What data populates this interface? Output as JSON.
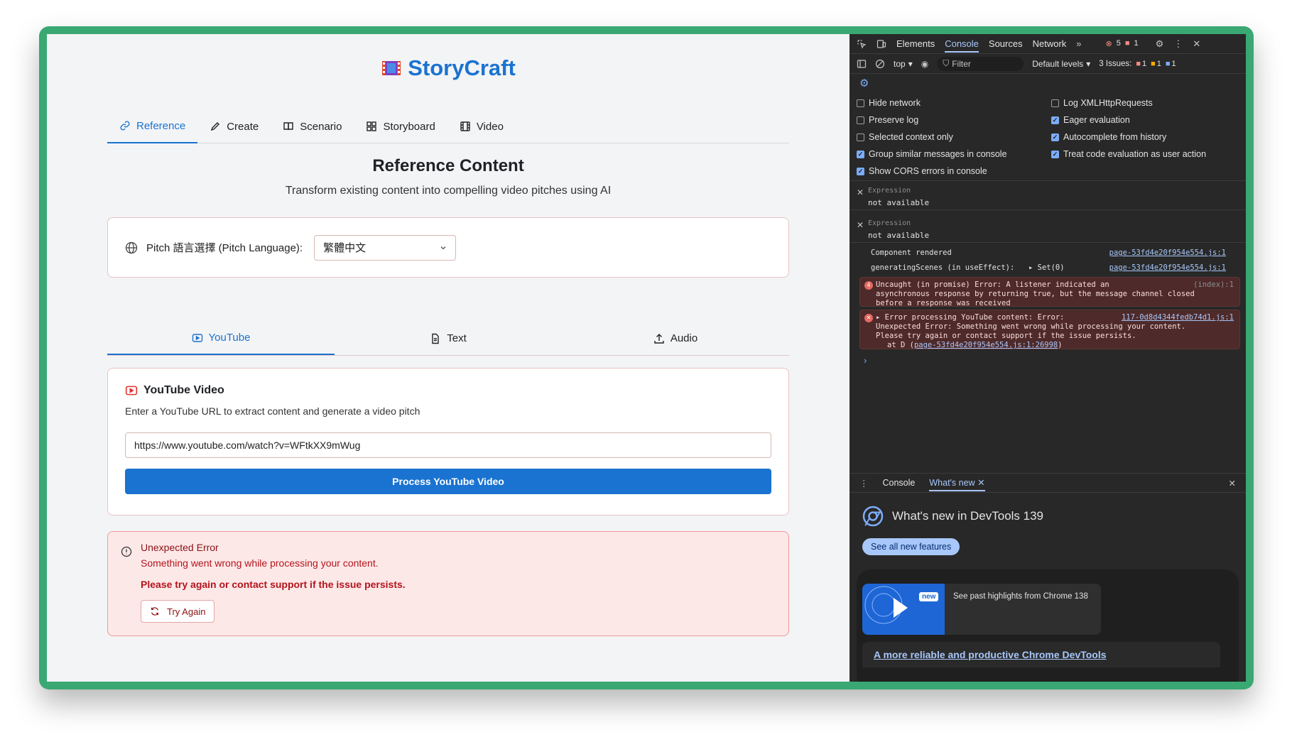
{
  "app": {
    "brand": "StoryCraft",
    "tabs": [
      {
        "label": "Reference",
        "icon": "link-icon"
      },
      {
        "label": "Create",
        "icon": "pencil-icon"
      },
      {
        "label": "Scenario",
        "icon": "book-icon"
      },
      {
        "label": "Storyboard",
        "icon": "grid-icon"
      },
      {
        "label": "Video",
        "icon": "film-icon"
      }
    ],
    "active_tab": "Reference",
    "heading": "Reference Content",
    "subheading": "Transform existing content into compelling video pitches using AI",
    "language": {
      "label": "Pitch 語言選擇 (Pitch Language):",
      "selected": "繁體中文"
    },
    "source_tabs": [
      {
        "label": "YouTube",
        "icon": "youtube-icon"
      },
      {
        "label": "Text",
        "icon": "document-icon"
      },
      {
        "label": "Audio",
        "icon": "upload-icon"
      }
    ],
    "active_source_tab": "YouTube",
    "youtube": {
      "title": "YouTube Video",
      "description": "Enter a YouTube URL to extract content and generate a video pitch",
      "url_value": "https://www.youtube.com/watch?v=WFtkXX9mWug",
      "button": "Process YouTube Video"
    },
    "error": {
      "title": "Unexpected Error",
      "message": "Something went wrong while processing your content.",
      "hint": "Please try again or contact support if the issue persists.",
      "retry": "Try Again"
    },
    "colors": {
      "accent": "#1a73d0",
      "error_bg": "#fde8e8",
      "error_text": "#b3141b"
    }
  },
  "devtools": {
    "tabs": [
      "Elements",
      "Console",
      "Sources",
      "Network"
    ],
    "active_tab": "Console",
    "error_count": "5",
    "warning_count": "1",
    "context": "top",
    "filter_placeholder": "Filter",
    "levels": "Default levels",
    "issues_label": "3 Issues:",
    "issues": {
      "red": "1",
      "orange": "1",
      "blue": "1"
    },
    "settings_left": [
      {
        "label": "Hide network",
        "checked": false
      },
      {
        "label": "Preserve log",
        "checked": false
      },
      {
        "label": "Selected context only",
        "checked": false
      },
      {
        "label": "Group similar messages in console",
        "checked": true
      },
      {
        "label": "Show CORS errors in console",
        "checked": true
      }
    ],
    "settings_right": [
      {
        "label": "Log XMLHttpRequests",
        "checked": false
      },
      {
        "label": "Eager evaluation",
        "checked": true
      },
      {
        "label": "Autocomplete from history",
        "checked": true
      },
      {
        "label": "Treat code evaluation as user action",
        "checked": true
      }
    ],
    "expressions": [
      {
        "label": "Expression",
        "value": "not available"
      },
      {
        "label": "Expression",
        "value": "not available"
      }
    ],
    "logs": [
      {
        "text": "Component rendered",
        "source": "page-53fd4e20f954e554.js:1"
      },
      {
        "text": "generatingScenes (in useEffect):",
        "extra": "▸ Set(0)",
        "source": "page-53fd4e20f954e554.js:1"
      }
    ],
    "error1": {
      "count": "4",
      "line1": "Uncaught (in promise) Error: A listener indicated an",
      "source": "(index):1",
      "line2": "asynchronous response by returning true, but the message channel closed",
      "line3": "before a response was received"
    },
    "error2": {
      "line1": "▸ Error processing YouTube content: Error:",
      "source": "117-0d8d4344fedb74d1.js:1",
      "line2": "Unexpected Error: Something went wrong while processing your content.",
      "line3": "Please try again or contact support if the issue persists.",
      "line4_prefix": "at D (",
      "line4_link": "page-53fd4e20f954e554.js:1:26998",
      "line4_suffix": ")"
    },
    "drawer": {
      "tabs": [
        "Console",
        "What's new"
      ],
      "active_tab": "What's new",
      "title": "What's new in DevTools 139",
      "button": "See all new features",
      "highlight_badge": "new",
      "highlight_text": "See past highlights from Chrome 138",
      "link": "A more reliable and productive Chrome DevTools"
    }
  }
}
